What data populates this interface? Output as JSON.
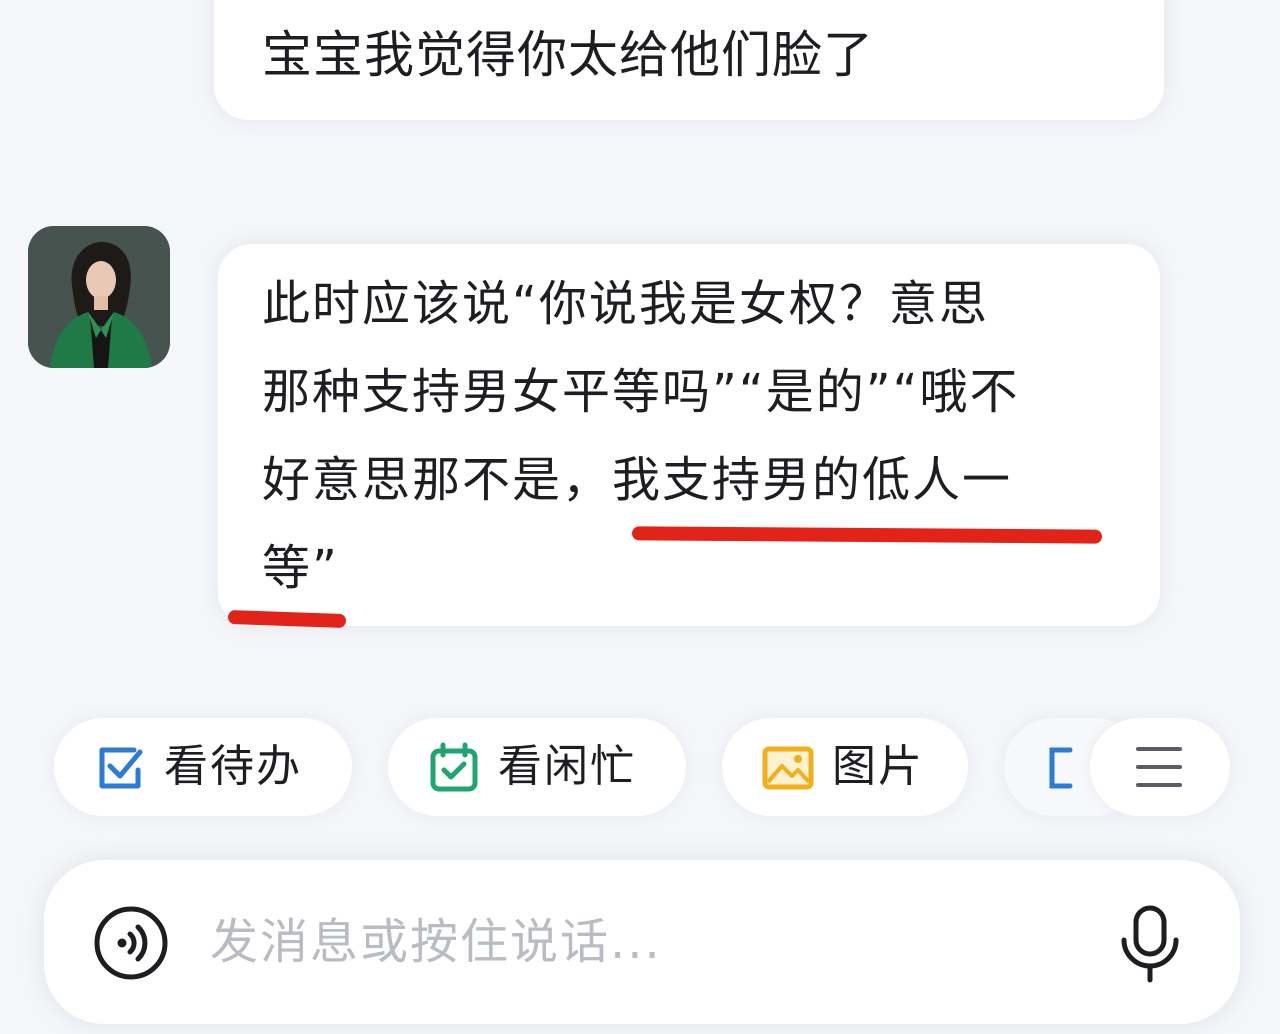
{
  "messages": {
    "user_message": "宝宝我觉得你太给他们脸了",
    "bot_message_lines": [
      "此时应该说“你说我是女权？意思",
      "那种支持男女平等吗”“是的”“哦不",
      "好意思那不是，我支持男的低人一",
      "等”"
    ]
  },
  "quick_actions": [
    {
      "label": "看待办",
      "icon": "checkbox-todo-icon"
    },
    {
      "label": "看闲忙",
      "icon": "calendar-check-icon"
    },
    {
      "label": "图片",
      "icon": "image-icon"
    }
  ],
  "input": {
    "placeholder": "发消息或按住说话..."
  },
  "colors": {
    "underline_annotation": "#e2231a",
    "icon_blue": "#2b7bd8",
    "icon_green": "#1fa572",
    "icon_yellow": "#f0b01c"
  }
}
